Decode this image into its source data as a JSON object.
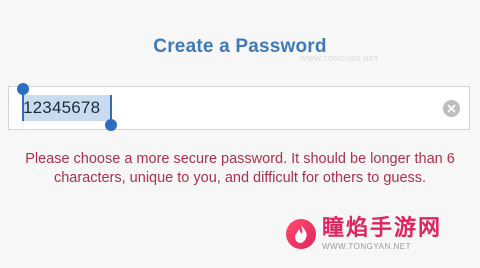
{
  "header": {
    "title": "Create a Password"
  },
  "password_field": {
    "value": "12345678",
    "clear_icon": "clear-circle-icon"
  },
  "error_message": "Please choose a more secure password. It should be longer than 6 characters, unique to you, and difficult for others to guess.",
  "watermark": {
    "title": "瞳焰手游网",
    "url": "WWW.TONGYAN.NET",
    "faint_url": "WWW.TONGYAN.NET"
  },
  "colors": {
    "title": "#3f79b8",
    "error": "#b0304a",
    "selection": "#c9dbef",
    "handle": "#2c6fc2",
    "watermark": "#e0245e"
  }
}
